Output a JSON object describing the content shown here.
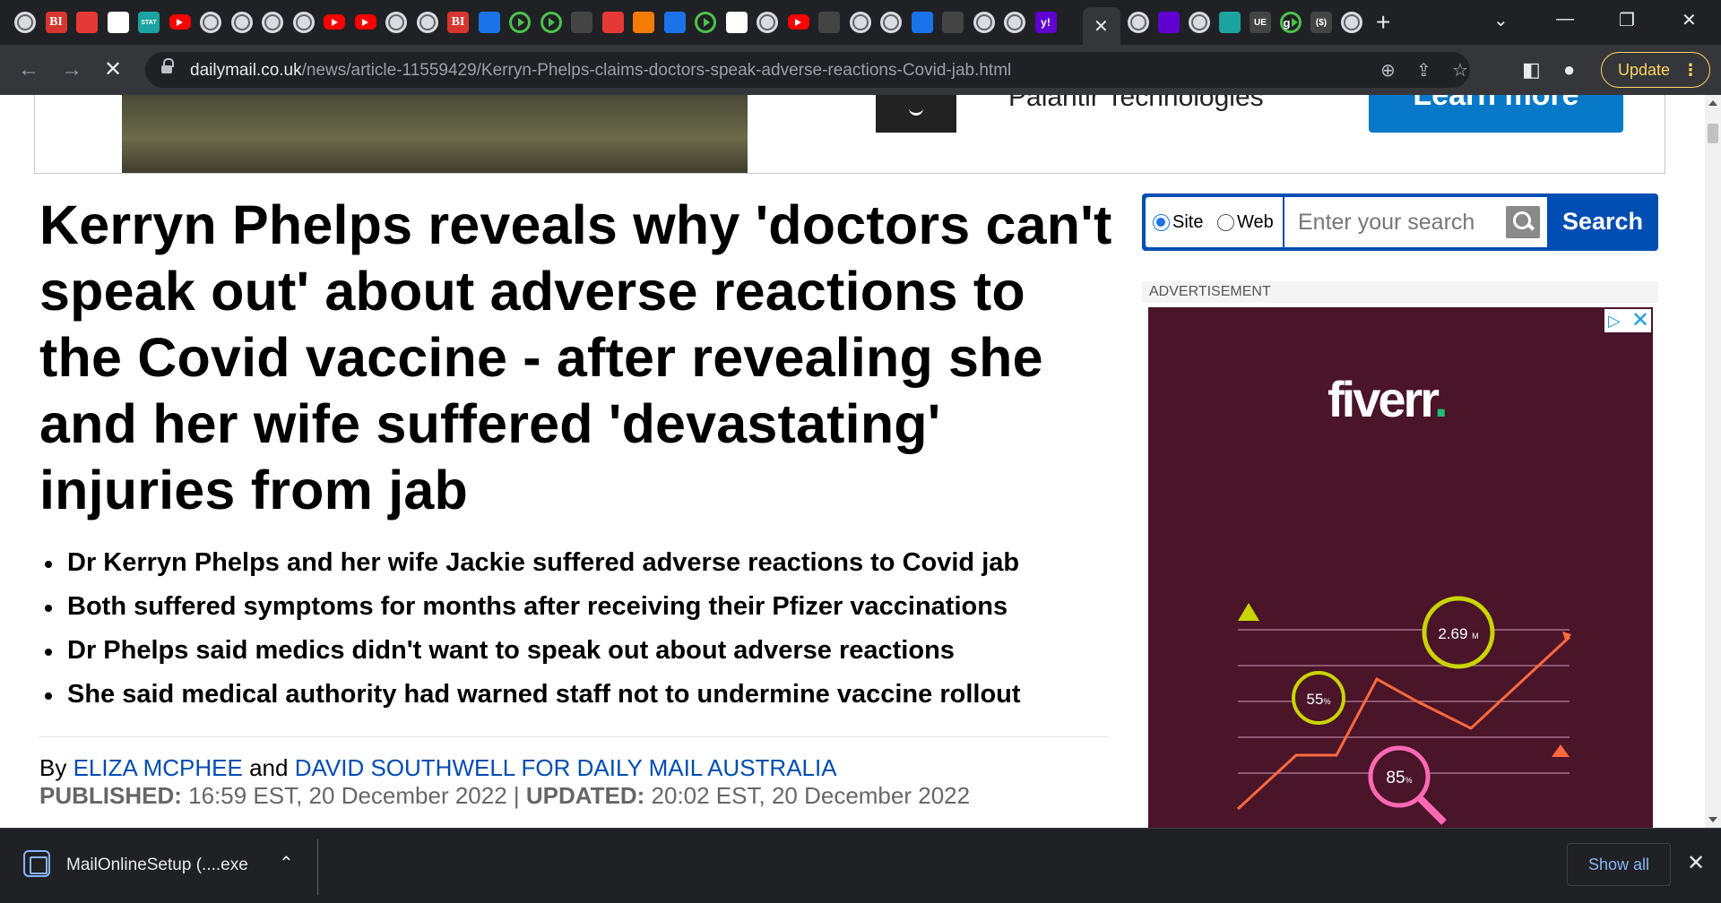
{
  "browser": {
    "tabs": {
      "icons": [
        "globe",
        "bi",
        "target",
        "white",
        "stat",
        "youtube",
        "globe",
        "globe",
        "globe",
        "globe",
        "youtube",
        "youtube",
        "globe",
        "globe",
        "bi",
        "media",
        "green-play",
        "green-play",
        "shield",
        "bookmark",
        "stack",
        "media",
        "green-play",
        "grid",
        "globe",
        "youtube",
        "tag",
        "globe",
        "globe",
        "media",
        "search",
        "globe",
        "globe",
        "yahoo"
      ],
      "active_close": "✕",
      "after_active_icons": [
        "globe",
        "yahoo-mail",
        "globe",
        "tree",
        "ue",
        "green-g",
        "dollar",
        "globe"
      ],
      "new_tab": "+",
      "stat_label": "STAT",
      "bi_label": "BI",
      "yahoo_label": "y!",
      "ue_label": "UE",
      "g_label": "g",
      "dollar_label": "($)"
    },
    "window_controls": {
      "minimize": "—",
      "restore": "❐",
      "close": "✕",
      "tab_search": "⌄"
    },
    "address": {
      "host": "dailymail.co.uk",
      "path": "/news/article-11559429/Kerryn-Phelps-claims-doctors-speak-adverse-reactions-Covid-jab.html"
    },
    "update_label": "Update",
    "update_dots": "⋮"
  },
  "top_ad": {
    "company": "Palantir Technologies",
    "cta": "Learn more"
  },
  "article": {
    "headline": "Kerryn Phelps reveals why 'doctors can't speak out' about adverse reactions to the Covid vaccine - after revealing she and her wife suffered 'devastating' injuries from jab",
    "bullets": [
      "Dr Kerryn Phelps and her wife Jackie suffered adverse reactions to Covid jab",
      "Both suffered symptoms for months after receiving their Pfizer vaccinations",
      "Dr Phelps said medics didn't want to speak out about adverse reactions",
      "She said medical authority had warned staff not to undermine vaccine rollout"
    ],
    "byline": {
      "prefix": "By ",
      "author1": "ELIZA MCPHEE",
      "joiner": " and ",
      "author2": "DAVID SOUTHWELL FOR DAILY MAIL AUSTRALIA"
    },
    "dates": {
      "published_label": "PUBLISHED:",
      "published": " 16:59 EST, 20 December 2022 | ",
      "updated_label": "UPDATED:",
      "updated": " 20:02 EST, 20 December 2022"
    }
  },
  "search": {
    "option_site": "Site",
    "option_web": "Web",
    "selected": "Site",
    "placeholder": "Enter your search",
    "button": "Search"
  },
  "side_ad": {
    "label": "ADVERTISEMENT",
    "brand": "fiverr",
    "brand_dot": ".",
    "stat1": "2.69",
    "stat1_unit": "M",
    "stat2": "55",
    "stat2_unit": "%",
    "stat3": "85",
    "stat3_unit": "%",
    "adchoices_icon": "▷",
    "adchoices_close": "✕"
  },
  "download_bar": {
    "file_name": "MailOnlineSetup (....exe",
    "chevron": "⌃",
    "show_all": "Show all",
    "close": "✕"
  },
  "colors": {
    "link": "#004db3",
    "search_blue": "#004db3",
    "ad_bg": "#4a1429",
    "fiverr_green": "#1dbf73",
    "update_yellow": "#fdd663"
  }
}
